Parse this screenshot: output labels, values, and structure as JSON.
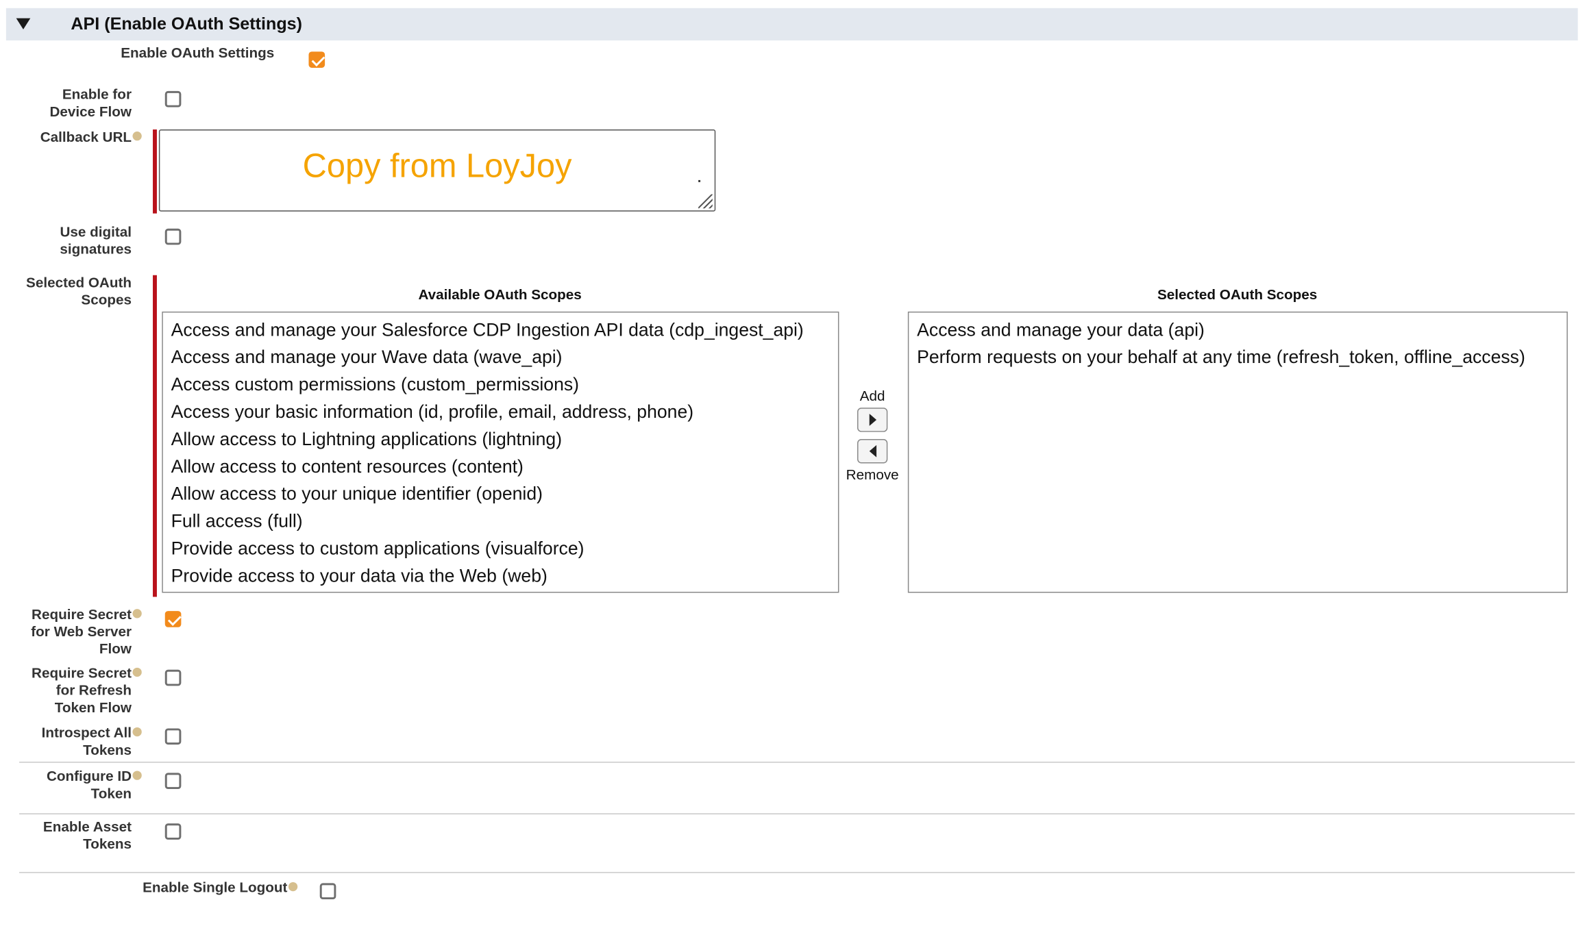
{
  "section": {
    "title": "API (Enable OAuth Settings)"
  },
  "fields": {
    "enable_oauth": {
      "label": "Enable OAuth Settings",
      "checked": true
    },
    "device_flow": {
      "label_line1": "Enable for",
      "label_line2": "Device Flow",
      "checked": false
    },
    "callback_url": {
      "label": "Callback URL",
      "value": "Copy from LoyJoy"
    },
    "digital_signatures": {
      "label_line1": "Use digital",
      "label_line2": "signatures",
      "checked": false
    },
    "selected_scopes": {
      "label_line1": "Selected OAuth",
      "label_line2": "Scopes"
    },
    "secret_web_server": {
      "label_line1": "Require Secret",
      "label_line2": "for Web Server",
      "label_line3": "Flow",
      "checked": true
    },
    "secret_refresh": {
      "label_line1": "Require Secret",
      "label_line2": "for Refresh",
      "label_line3": "Token Flow",
      "checked": false
    },
    "introspect": {
      "label_line1": "Introspect All",
      "label_line2": "Tokens",
      "checked": false
    },
    "id_token": {
      "label_line1": "Configure ID",
      "label_line2": "Token",
      "checked": false
    },
    "asset_tokens": {
      "label_line1": "Enable Asset",
      "label_line2": "Tokens",
      "checked": false
    },
    "single_logout": {
      "label": "Enable Single Logout",
      "checked": false
    }
  },
  "scopes": {
    "available_title": "Available OAuth Scopes",
    "selected_title": "Selected OAuth Scopes",
    "add_label": "Add",
    "remove_label": "Remove",
    "available": [
      "Access and manage your Salesforce CDP Ingestion API data (cdp_ingest_api)",
      "Access and manage your Wave data (wave_api)",
      "Access custom permissions (custom_permissions)",
      "Access your basic information (id, profile, email, address, phone)",
      "Allow access to Lightning applications (lightning)",
      "Allow access to content resources (content)",
      "Allow access to your unique identifier (openid)",
      "Full access (full)",
      "Provide access to custom applications (visualforce)",
      "Provide access to your data via the Web (web)"
    ],
    "selected": [
      "Access and manage your data (api)",
      "Perform requests on your behalf at any time (refresh_token, offline_access)"
    ]
  },
  "icons": {
    "collapse": "collapse-triangle-icon",
    "help": "help-icon",
    "add": "arrow-right-icon",
    "remove": "arrow-left-icon",
    "resize": "resize-grip-icon"
  },
  "colors": {
    "accent_checkbox": "#f28b1c",
    "required_bar": "#b9121b",
    "callback_text": "#f5a300",
    "section_bg": "#e3e8ef"
  }
}
